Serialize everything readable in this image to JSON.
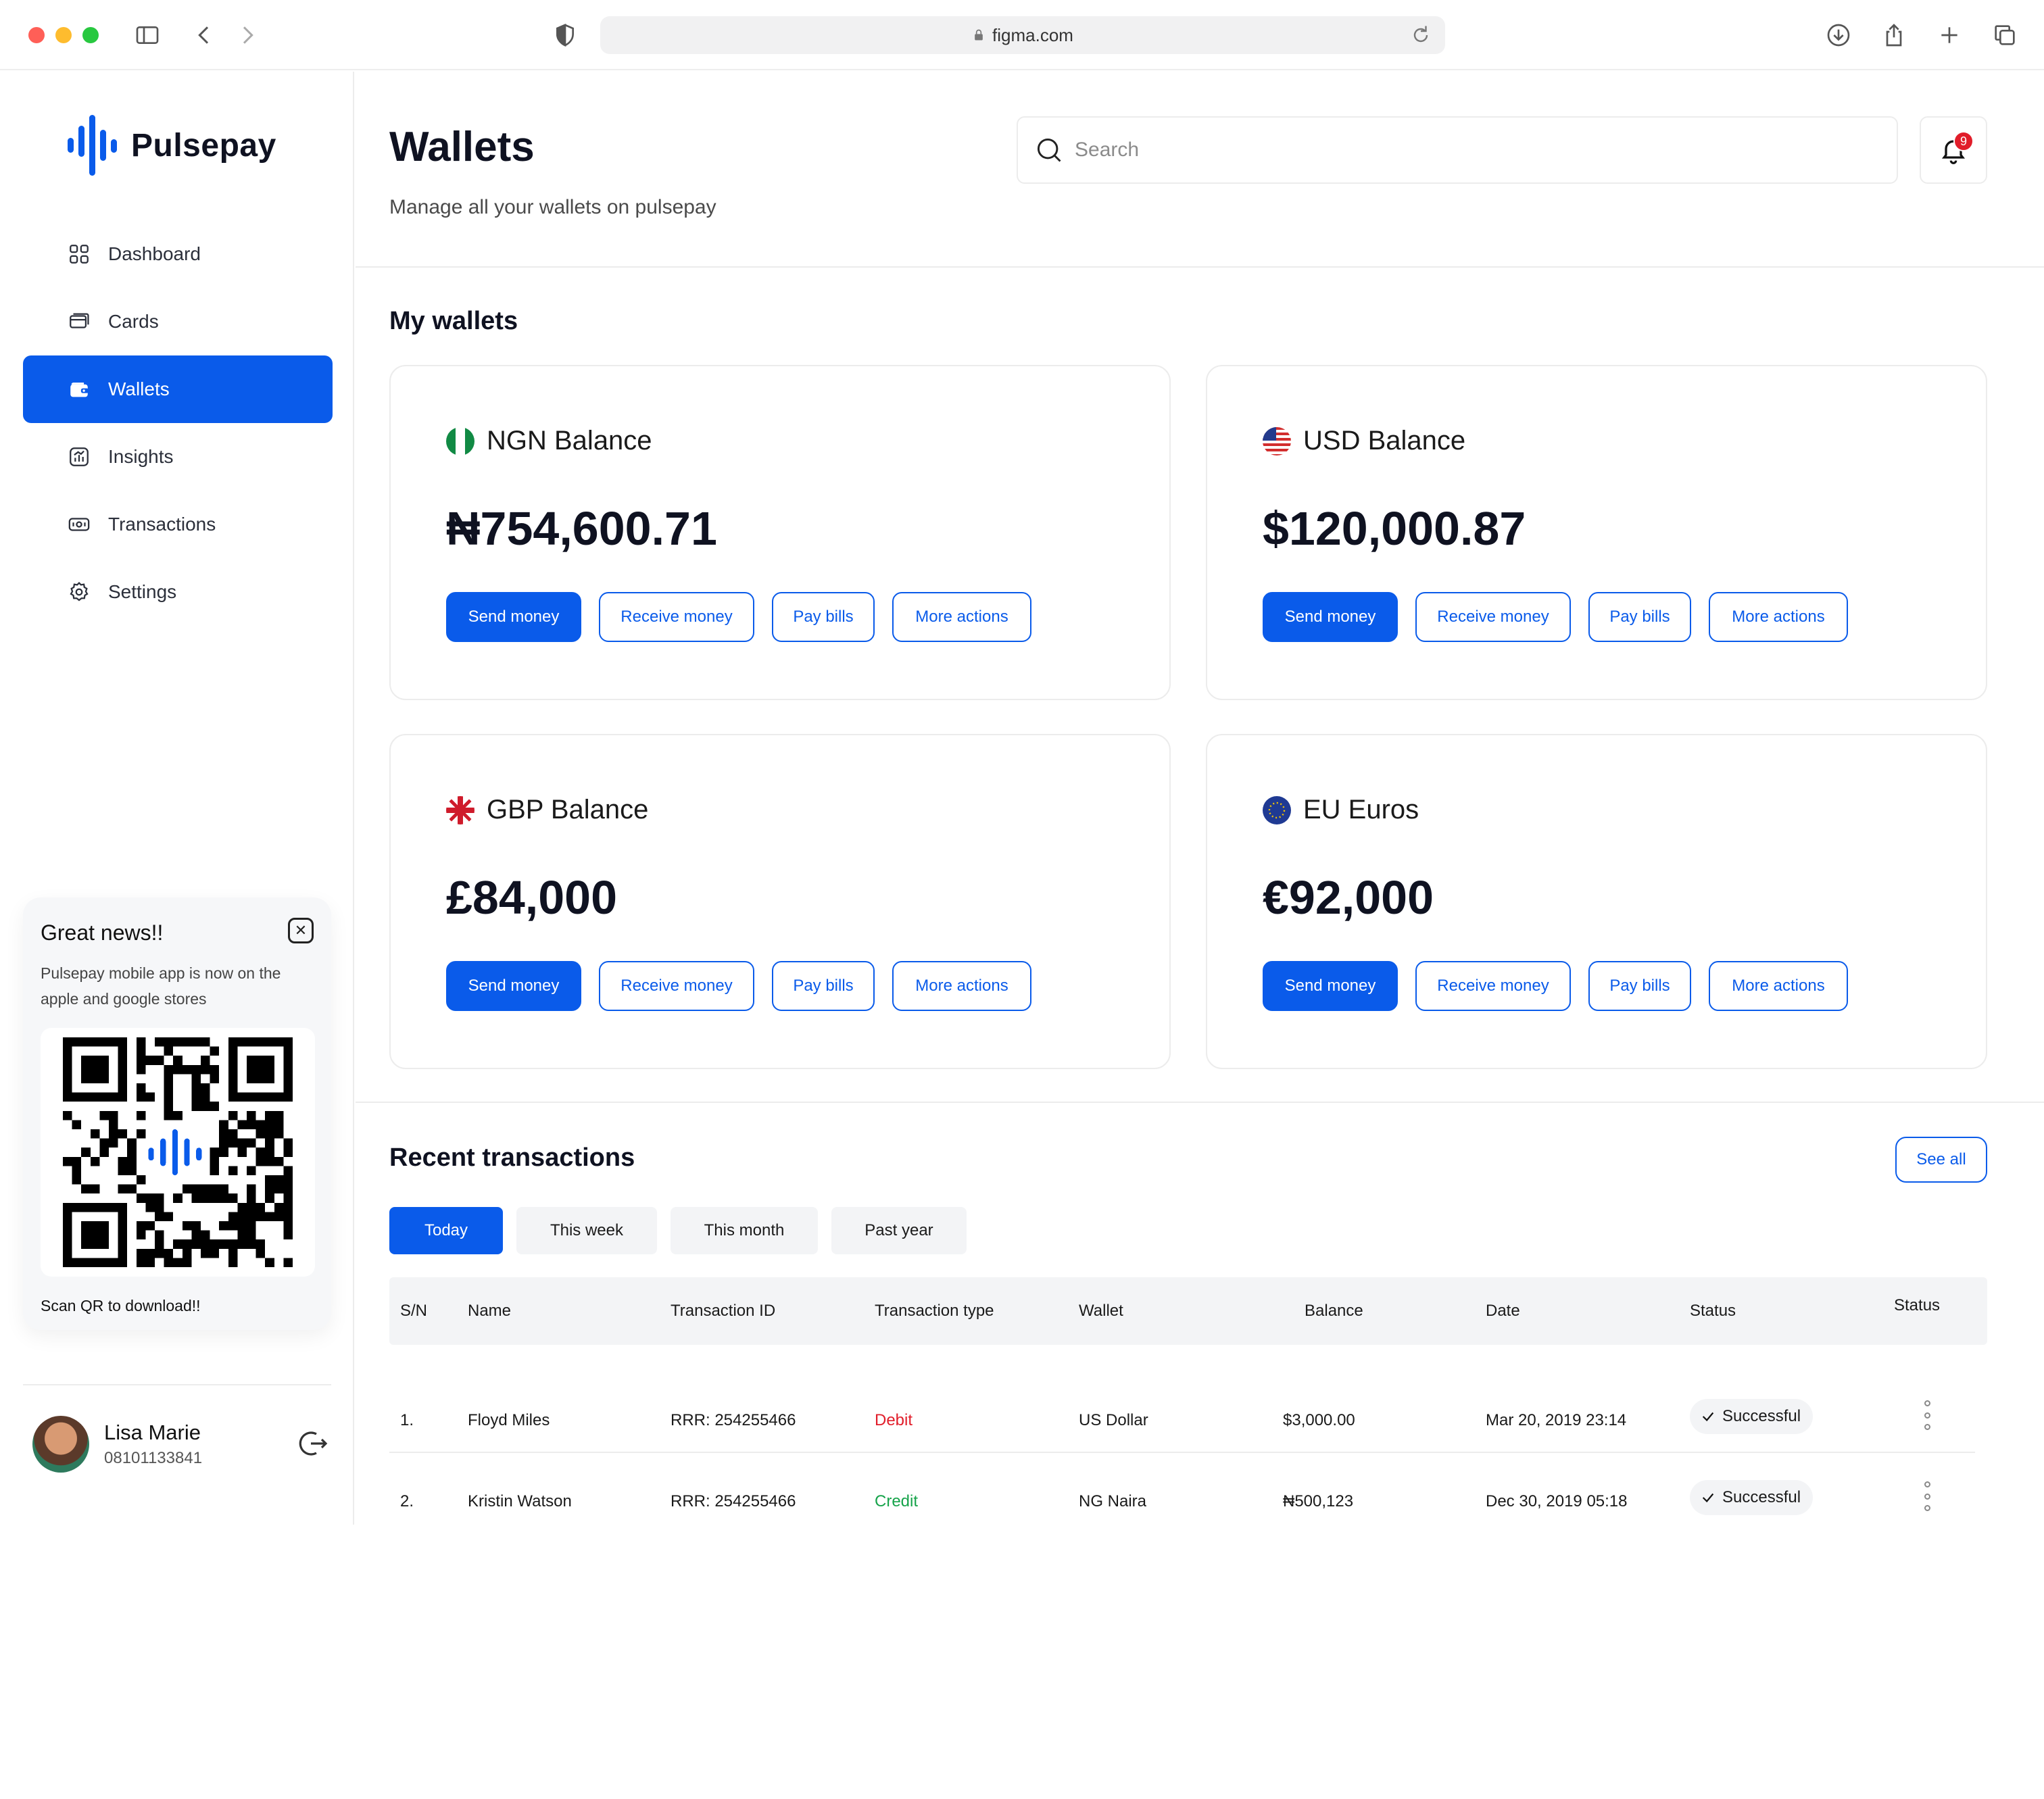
{
  "browser": {
    "url": "figma.com"
  },
  "brand": {
    "name": "Pulsepay",
    "accent": "#0a5bea"
  },
  "sidebar": {
    "items": [
      {
        "label": "Dashboard",
        "icon": "grid-icon",
        "active": false
      },
      {
        "label": "Cards",
        "icon": "card-icon",
        "active": false
      },
      {
        "label": "Wallets",
        "icon": "wallet-icon",
        "active": true
      },
      {
        "label": "Insights",
        "icon": "chart-icon",
        "active": false
      },
      {
        "label": "Transactions",
        "icon": "cash-icon",
        "active": false
      },
      {
        "label": "Settings",
        "icon": "gear-icon",
        "active": false
      }
    ],
    "promo": {
      "title": "Great news!!",
      "text": "Pulsepay mobile app is now on the apple and google stores",
      "footer": "Scan QR to download!!"
    },
    "user": {
      "name": "Lisa Marie",
      "phone": "08101133841"
    }
  },
  "header": {
    "title": "Wallets",
    "subtitle": "Manage all your wallets on pulsepay",
    "search_placeholder": "Search",
    "notification_count": "9"
  },
  "wallets": {
    "title": "My wallets",
    "cards": [
      {
        "name": "NGN Balance",
        "amount": "₦754,600.71",
        "flag": "ng-flag-icon"
      },
      {
        "name": "USD Balance",
        "amount": "$120,000.87",
        "flag": "us-flag-icon"
      },
      {
        "name": "GBP Balance",
        "amount": "£84,000",
        "flag": "gb-flag-icon"
      },
      {
        "name": "EU Euros",
        "amount": "€92,000",
        "flag": "eu-flag-icon"
      }
    ],
    "actions": {
      "send": "Send money",
      "receive": "Receive money",
      "pay": "Pay bills",
      "more": "More actions"
    }
  },
  "transactions": {
    "title": "Recent transactions",
    "see_all": "See all",
    "filters": [
      "Today",
      "This week",
      "This month",
      "Past year"
    ],
    "active_filter": "Today",
    "columns": [
      "S/N",
      "Name",
      "Transaction ID",
      "Transaction type",
      "Wallet",
      "Balance",
      "Date",
      "Status",
      "Status"
    ],
    "rows": [
      {
        "sn": "1.",
        "name": "Floyd Miles",
        "txid": "RRR:  254255466",
        "type": "Debit",
        "wallet": "US Dollar",
        "balance": "$3,000.00",
        "date": "Mar 20, 2019 23:14",
        "status": "Successful"
      },
      {
        "sn": "2.",
        "name": "Kristin Watson",
        "txid": "RRR:  254255466",
        "type": "Credit",
        "wallet": "NG Naira",
        "balance": "₦500,123",
        "date": "Dec 30, 2019 05:18",
        "status": "Successful"
      }
    ],
    "colors": {
      "debit": "#e11d2a",
      "credit": "#16a34a"
    }
  }
}
